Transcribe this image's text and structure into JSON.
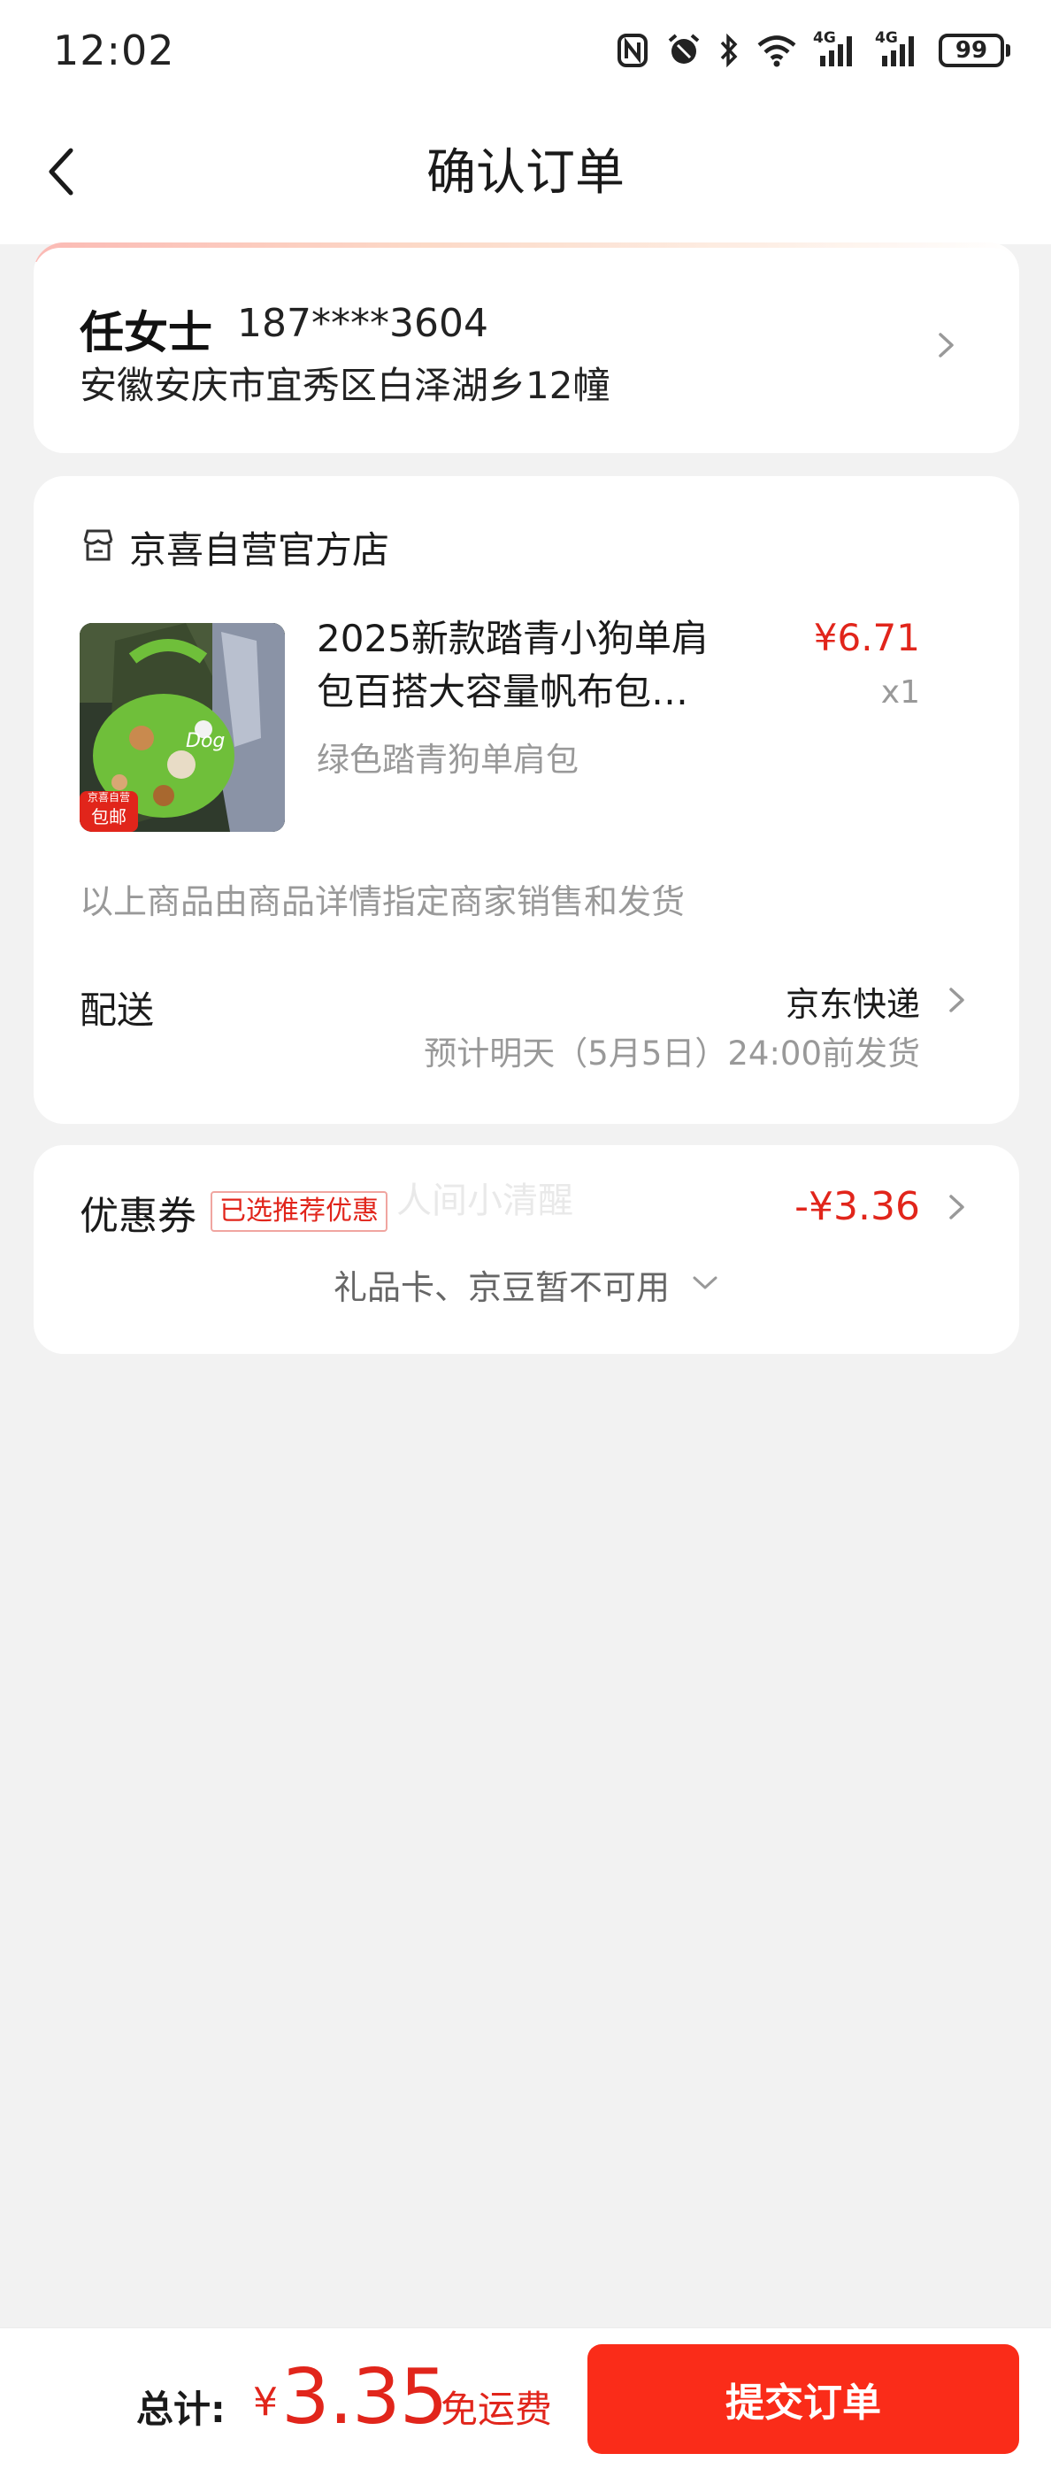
{
  "status_bar": {
    "time": "12:02",
    "network_1": "4G",
    "network_2": "4G",
    "battery": "99",
    "icons": [
      "nfc-icon",
      "alarm-icon",
      "bluetooth-icon",
      "wifi-icon",
      "signal-icon",
      "signal-icon",
      "battery-icon"
    ]
  },
  "nav": {
    "title": "确认订单",
    "back_icon": "chevron-left-icon"
  },
  "address": {
    "name": "任女士",
    "phone": "187****3604",
    "detail": "安徽安庆市宜秀区白泽湖乡12幢"
  },
  "order": {
    "store_name": "京喜自营官方店",
    "store_icon": "store-icon",
    "product": {
      "title": "2025新款踏青小狗单肩包百搭大容量帆布包…",
      "spec": "绿色踏青狗单肩包",
      "price": "¥6.71",
      "quantity": "x1",
      "badge_top": "京喜自营",
      "badge_bottom": "包邮"
    },
    "seller_note": "以上商品由商品详情指定商家销售和发货",
    "shipping": {
      "label": "配送",
      "method": "京东快递",
      "eta": "预计明天（5月5日）24:00前发货"
    }
  },
  "coupon": {
    "label": "优惠券",
    "badge": "已选推荐优惠",
    "watermark": "人间小清醒",
    "amount": "-¥3.36",
    "giftcard_note": "礼品卡、京豆暂不可用"
  },
  "footer": {
    "total_label": "总计:",
    "currency": "¥",
    "total_amount": "3.35",
    "free_shipping": "免运费",
    "submit_label": "提交订单"
  },
  "colors": {
    "accent_red": "#e1251b",
    "submit_red": "#fa2c19",
    "background": "#f2f2f2"
  }
}
